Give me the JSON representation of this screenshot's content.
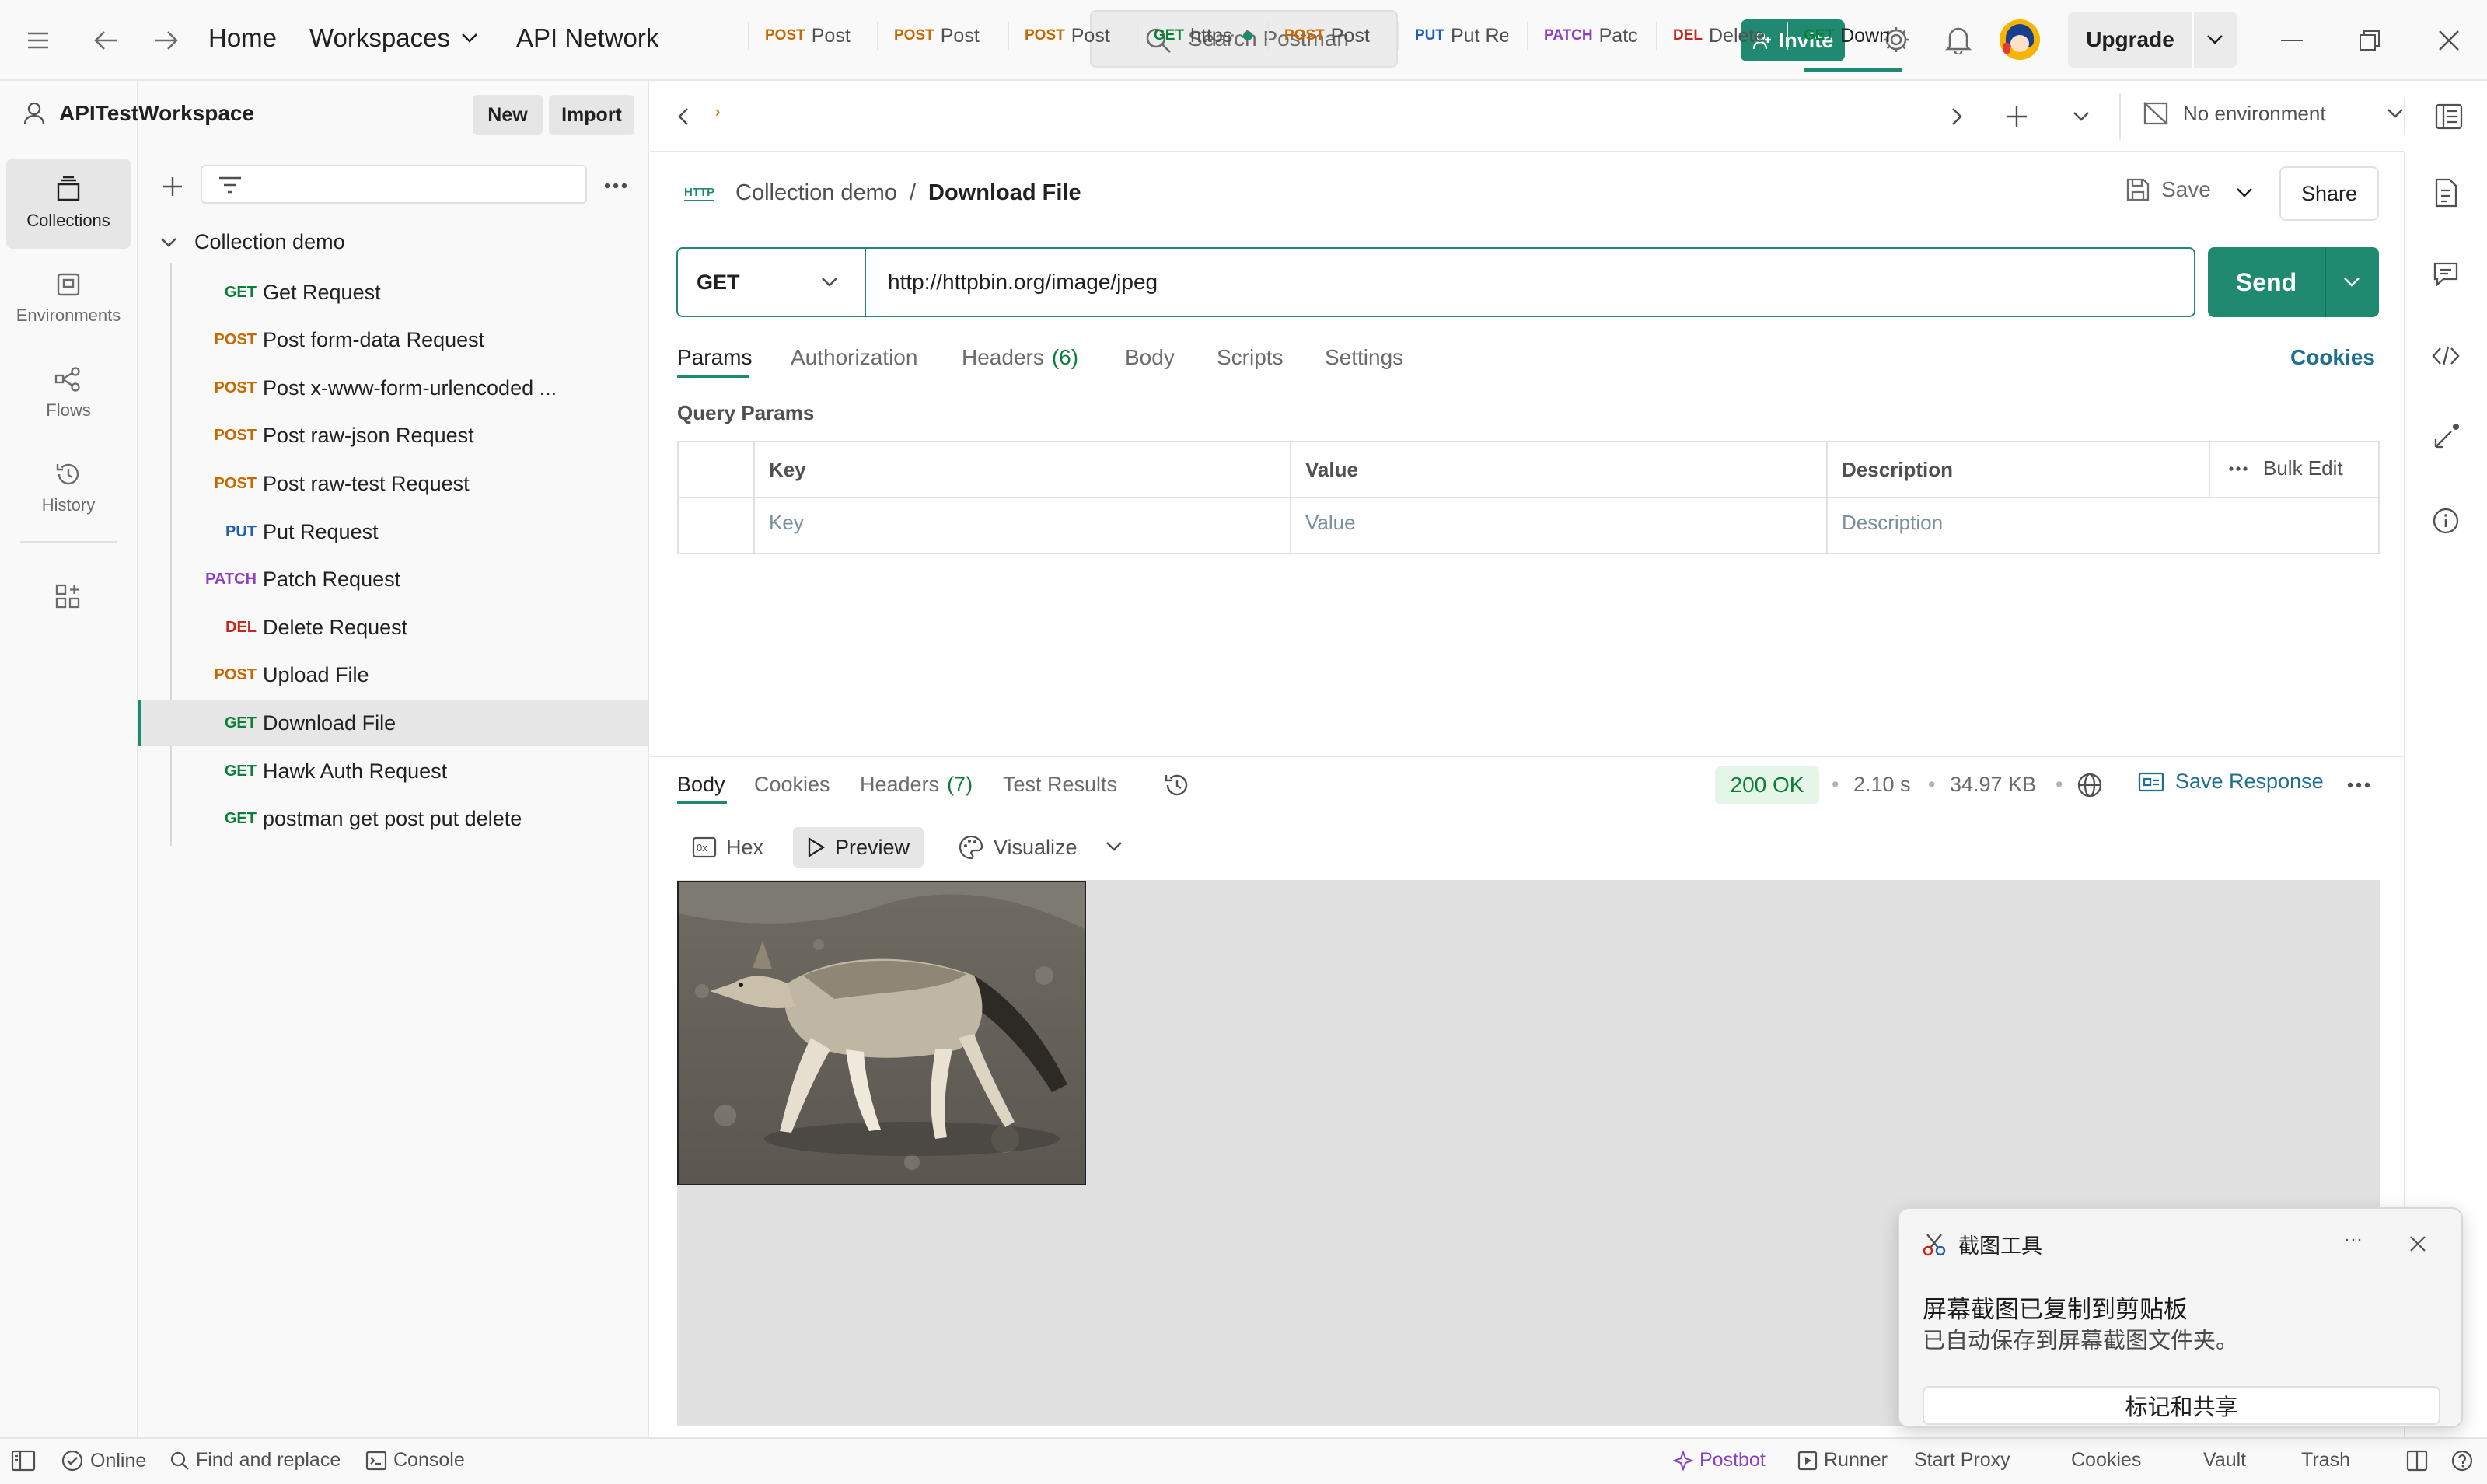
{
  "topbar": {
    "home": "Home",
    "workspaces": "Workspaces",
    "api_network": "API Network",
    "search_placeholder": "Search Postman",
    "invite": "Invite",
    "upgrade": "Upgrade"
  },
  "leftnav": {
    "items": [
      {
        "label": "Collections",
        "icon": "collections-icon"
      },
      {
        "label": "Environments",
        "icon": "environments-icon"
      },
      {
        "label": "Flows",
        "icon": "flows-icon"
      },
      {
        "label": "History",
        "icon": "history-icon"
      }
    ]
  },
  "workspace": {
    "name": "APITestWorkspace",
    "new": "New",
    "import": "Import"
  },
  "collection": {
    "name": "Collection demo",
    "requests": [
      {
        "method": "GET",
        "name": "Get Request"
      },
      {
        "method": "POST",
        "name": "Post form-data Request"
      },
      {
        "method": "POST",
        "name": "Post x-www-form-urlencoded ..."
      },
      {
        "method": "POST",
        "name": "Post raw-json Request"
      },
      {
        "method": "POST",
        "name": "Post raw-test Request"
      },
      {
        "method": "PUT",
        "name": "Put Request"
      },
      {
        "method": "PATCH",
        "name": "Patch Request"
      },
      {
        "method": "DEL",
        "name": "Delete Request"
      },
      {
        "method": "POST",
        "name": "Upload File"
      },
      {
        "method": "GET",
        "name": "Download File"
      },
      {
        "method": "GET",
        "name": "Hawk Auth Request"
      },
      {
        "method": "GET",
        "name": "postman get post put delete"
      }
    ]
  },
  "tabs": [
    {
      "method": "POST",
      "label": "Post"
    },
    {
      "method": "POST",
      "label": "Post"
    },
    {
      "method": "POST",
      "label": "Post"
    },
    {
      "method": "GET",
      "label": "https"
    },
    {
      "method": "POST",
      "label": "Post"
    },
    {
      "method": "PUT",
      "label": "Put Re"
    },
    {
      "method": "PATCH",
      "label": "Patc"
    },
    {
      "method": "DEL",
      "label": "Delete"
    },
    {
      "method": "GET",
      "label": "Down"
    }
  ],
  "environment": "No environment",
  "request": {
    "breadcrumb_collection": "Collection demo",
    "breadcrumb_sep": "/",
    "title": "Download File",
    "save": "Save",
    "share": "Share",
    "method": "GET",
    "url": "http://httpbin.org/image/jpeg",
    "send": "Send",
    "tabs": [
      "Params",
      "Authorization",
      "Headers",
      "Body",
      "Scripts",
      "Settings"
    ],
    "headers_count": "(6)",
    "cookies": "Cookies",
    "query_params_label": "Query Params",
    "table": {
      "headers": [
        "Key",
        "Value",
        "Description"
      ],
      "bulk_edit": "Bulk Edit",
      "placeholders": [
        "Key",
        "Value",
        "Description"
      ]
    }
  },
  "response": {
    "tabs": [
      "Body",
      "Cookies",
      "Headers",
      "Test Results"
    ],
    "headers_count": "(7)",
    "status": "200 OK",
    "time": "2.10 s",
    "size": "34.97 KB",
    "save_response": "Save Response",
    "view_modes": [
      "Hex",
      "Preview",
      "Visualize"
    ]
  },
  "statusbar": {
    "online": "Online",
    "find_replace": "Find and replace",
    "console": "Console",
    "postbot": "Postbot",
    "runner": "Runner",
    "start_proxy": "Start Proxy",
    "cookies": "Cookies",
    "vault": "Vault",
    "trash": "Trash"
  },
  "toast": {
    "app": "截图工具",
    "title": "屏幕截图已复制到剪贴板",
    "body": "已自动保存到屏幕截图文件夹。",
    "action": "标记和共享",
    "more": "···"
  },
  "colors": {
    "accent": "#1f8a70",
    "get": "#0b7f3a",
    "post": "#c46a00",
    "put": "#1f5fb4",
    "patch": "#8c3ec5",
    "del": "#c4271b"
  }
}
